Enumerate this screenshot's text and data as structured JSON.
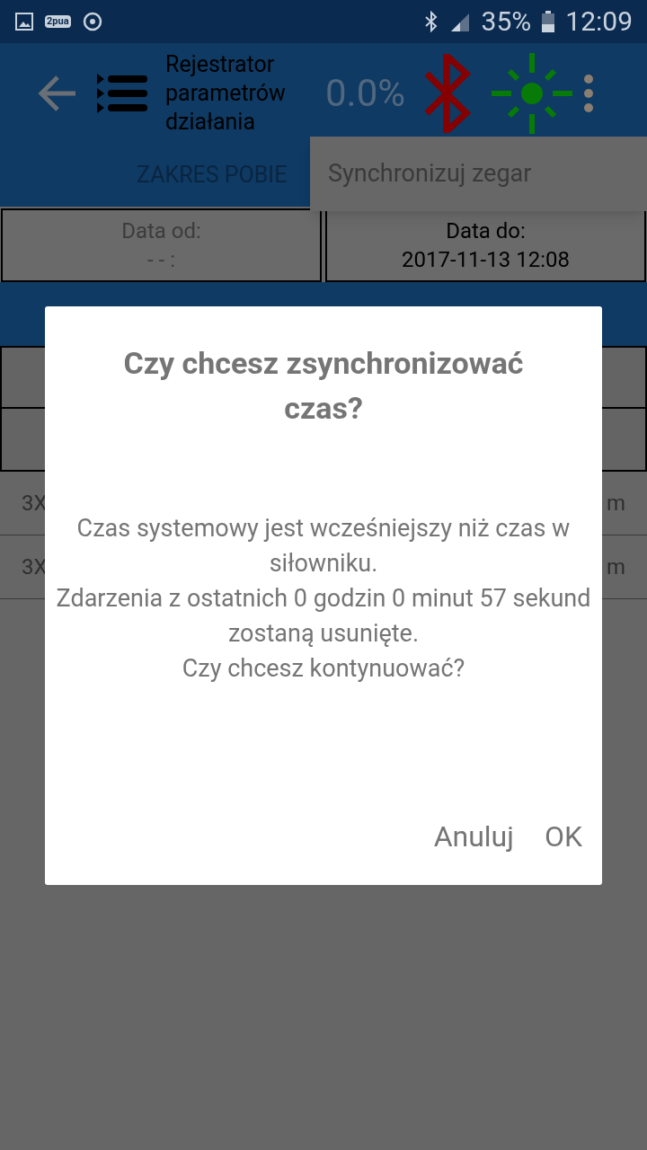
{
  "status_bar": {
    "badge": "2pua",
    "battery": "35%",
    "time": "12:09"
  },
  "toolbar": {
    "title": "Rejestrator parametrów działania",
    "progress": "0.0%"
  },
  "tab": {
    "label": "ZAKRES POBIE"
  },
  "menu": {
    "items": [
      {
        "label": "Synchronizuj zegar"
      }
    ]
  },
  "date_range": [
    {
      "label": "Data od:",
      "value": "- - :",
      "selected": false
    },
    {
      "label": "Data do:",
      "value": "2017-11-13 12:08",
      "selected": true
    }
  ],
  "list_rows": [
    {
      "column_1": "3X",
      "column_2": "m"
    },
    {
      "column_1": "3X",
      "column_2": "m"
    }
  ],
  "dialog": {
    "title": "Czy chcesz zsynchronizować czas?",
    "message": [
      "Czas systemowy jest wcześniejszy niż czas w siłowniku.",
      "Zdarzenia z ostatnich 0 godzin 0 minut 57 sekund zostaną usunięte.",
      "Czy chcesz kontynuować?"
    ],
    "buttons": [
      "Anuluj",
      "OK"
    ]
  }
}
